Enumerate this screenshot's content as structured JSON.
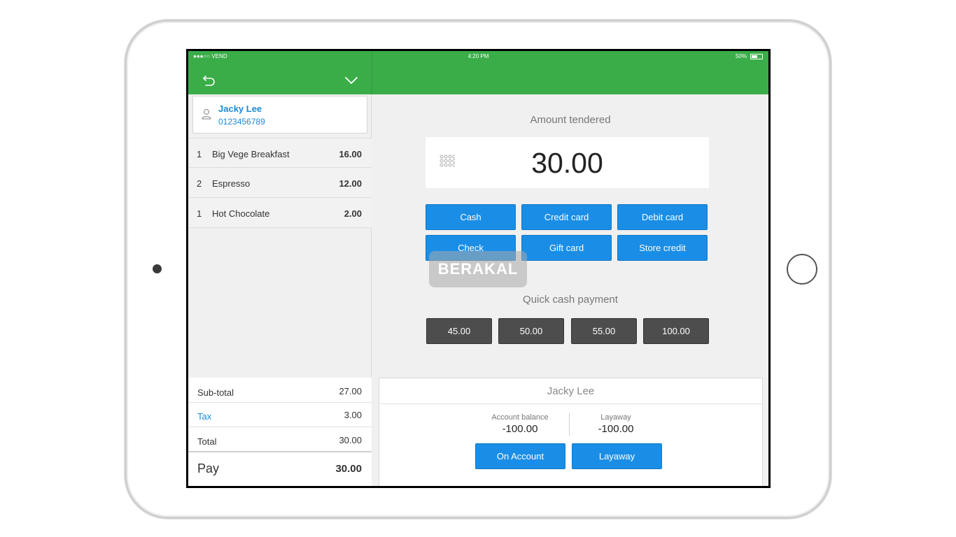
{
  "status_bar": {
    "carrier": "●●●○○ VEND",
    "time": "4:20 PM",
    "battery": "50%"
  },
  "customer": {
    "name": "Jacky Lee",
    "phone": "0123456789"
  },
  "items": [
    {
      "qty": "1",
      "name": "Big Vege Breakfast",
      "price": "16.00"
    },
    {
      "qty": "2",
      "name": "Espresso",
      "price": "12.00"
    },
    {
      "qty": "1",
      "name": "Hot Chocolate",
      "price": "2.00"
    }
  ],
  "totals": {
    "subtotal_label": "Sub-total",
    "subtotal": "27.00",
    "tax_label": "Tax",
    "tax": "3.00",
    "total_label": "Total",
    "total": "30.00",
    "pay_label": "Pay",
    "pay": "30.00"
  },
  "tender": {
    "title": "Amount tendered",
    "amount": "30.00"
  },
  "payment_methods": [
    "Cash",
    "Credit card",
    "Debit card",
    "Check",
    "Gift card",
    "Store credit"
  ],
  "quick_cash": {
    "title": "Quick cash payment",
    "options": [
      "45.00",
      "50.00",
      "55.00",
      "100.00"
    ]
  },
  "account": {
    "name": "Jacky Lee",
    "balance_label": "Account balance",
    "balance": "-100.00",
    "layaway_label": "Layaway",
    "layaway": "-100.00",
    "on_account_btn": "On Account",
    "layaway_btn": "Layaway"
  },
  "watermark": "BERAKAL",
  "colors": {
    "header_green": "#3aad48",
    "accent_blue": "#1a8ee6",
    "quick_dark": "#4d4d4d"
  }
}
